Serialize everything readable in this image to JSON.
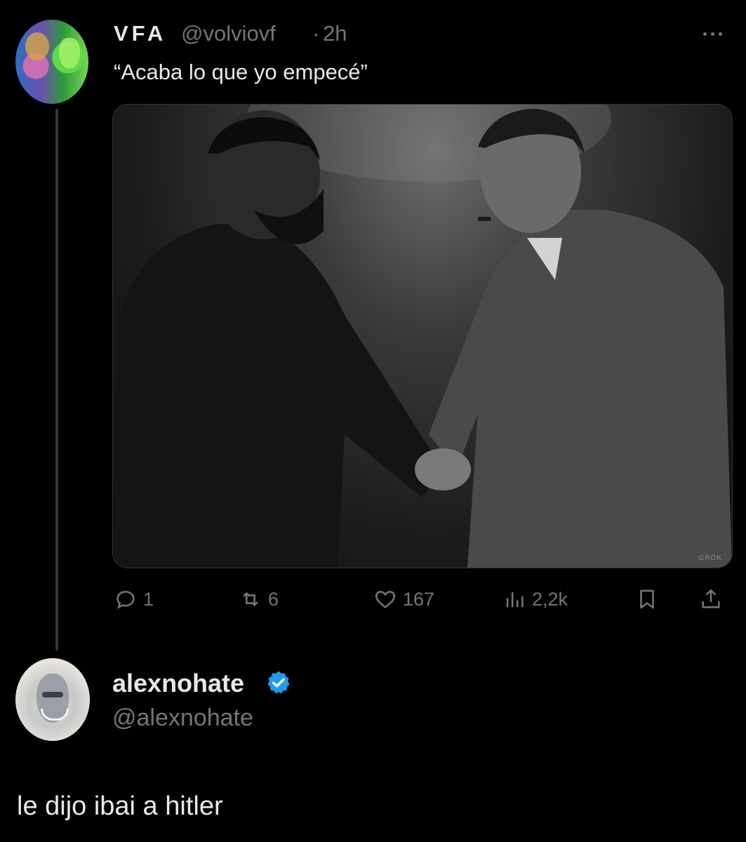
{
  "tweet": {
    "author_name": "VFA",
    "author_handle": "@volviovf",
    "separator": "·",
    "time": "2h",
    "text": "“Acaba lo que yo empecé”",
    "media_watermark": "GROK",
    "actions": {
      "replies": "1",
      "retweets": "6",
      "likes": "167",
      "views": "2,2k"
    }
  },
  "reply": {
    "author_name": "alexnohate",
    "author_handle": "@alexnohate",
    "verified": true,
    "text": "le dijo ibai a hitler"
  },
  "colors": {
    "background": "#000000",
    "primary_text": "#e7e9ea",
    "secondary_text": "#71767b",
    "verified_badge": "#1d9bf0",
    "thread_line": "#333639"
  }
}
